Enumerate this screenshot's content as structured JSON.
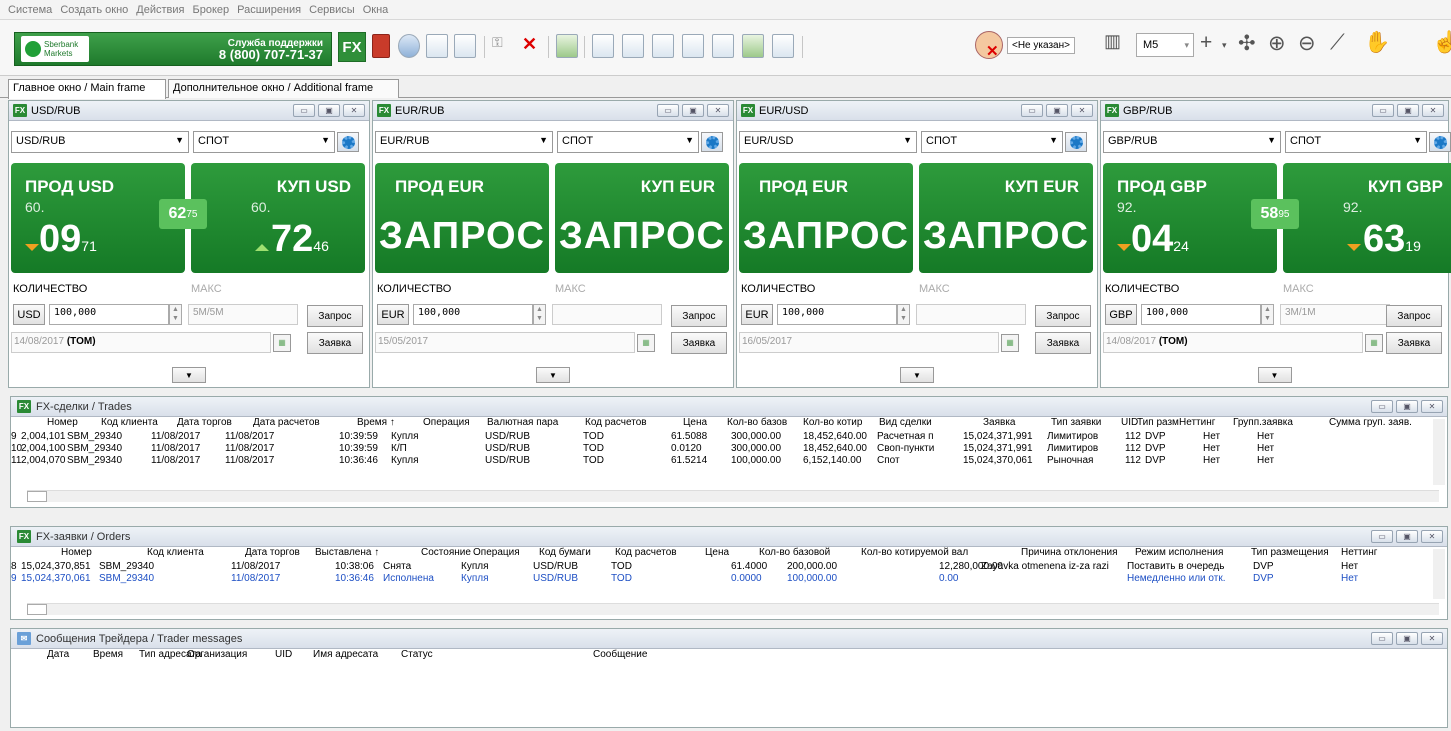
{
  "menu": [
    "Система",
    "Создать окно",
    "Действия",
    "Брокер",
    "Расширения",
    "Сервисы",
    "Окна"
  ],
  "toolbar": {
    "brand_line1": "Sberbank",
    "brand_line2": "Markets",
    "support_label": "Служба поддержки",
    "support_phone": "8 (800) 707-71-37",
    "fx_label": "FX",
    "user_name": "<Не указан>",
    "timeframe": "M5"
  },
  "tabs": [
    "Главное окно / Main frame",
    "Дополнительное окно / Additional frame"
  ],
  "panels": [
    {
      "title": "USD/RUB",
      "pair": "USD/RUB",
      "settle": "СПОТ",
      "sell_label": "ПРОД USD",
      "buy_label": "КУП USD",
      "sell_big": "60.",
      "sell_main": "09",
      "sell_frac": "71",
      "buy_big": "60.",
      "buy_main": "72",
      "buy_frac": "46",
      "spread_main": "62",
      "spread_frac": "75",
      "qty_label": "КОЛИЧЕСТВО",
      "max_label": "МАКС",
      "ccy": "USD",
      "amount": "100,000",
      "max_val": "5M/5M",
      "req_btn": "Запрос",
      "date": "14/08/2017",
      "tenor": "(TOM)",
      "order_btn": "Заявка"
    },
    {
      "title": "EUR/RUB",
      "pair": "EUR/RUB",
      "settle": "СПОТ",
      "sell_label": "ПРОД EUR",
      "buy_label": "КУП EUR",
      "sell_req": "ЗАПРОС",
      "buy_req": "ЗАПРОС",
      "qty_label": "КОЛИЧЕСТВО",
      "max_label": "МАКС",
      "ccy": "EUR",
      "amount": "100,000",
      "max_val": "",
      "req_btn": "Запрос",
      "date": "15/05/2017",
      "tenor": "",
      "order_btn": "Заявка"
    },
    {
      "title": "EUR/USD",
      "pair": "EUR/USD",
      "settle": "СПОТ",
      "sell_label": "ПРОД EUR",
      "buy_label": "КУП EUR",
      "sell_req": "ЗАПРОС",
      "buy_req": "ЗАПРОС",
      "qty_label": "КОЛИЧЕСТВО",
      "max_label": "МАКС",
      "ccy": "EUR",
      "amount": "100,000",
      "max_val": "",
      "req_btn": "Запрос",
      "date": "16/05/2017",
      "tenor": "",
      "order_btn": "Заявка"
    },
    {
      "title": "GBP/RUB",
      "pair": "GBP/RUB",
      "settle": "СПОТ",
      "sell_label": "ПРОД GBP",
      "buy_label": "КУП GBP",
      "sell_big": "92.",
      "sell_main": "04",
      "sell_frac": "24",
      "buy_big": "92.",
      "buy_main": "63",
      "buy_frac": "19",
      "spread_main": "58",
      "spread_frac": "95",
      "qty_label": "КОЛИЧЕСТВО",
      "max_label": "МАКС",
      "ccy": "GBP",
      "amount": "100,000",
      "max_val": "3M/1M",
      "req_btn": "Запрос",
      "date": "14/08/2017",
      "tenor": "(TOM)",
      "order_btn": "Заявка"
    }
  ],
  "trades": {
    "title": "FX-сделки / Trades",
    "headers": [
      "Номер",
      "Код клиента",
      "Дата торгов",
      "Дата расчетов",
      "Время",
      "Операция",
      "Валютная пара",
      "Код расчетов",
      "Цена",
      "Кол-во базов",
      "Кол-во котир",
      "Вид сделки",
      "Заявка",
      "Тип заявки",
      "UID",
      "Тип разм",
      "Неттинг",
      "Групп.заявка",
      "Сумма груп. заяв."
    ],
    "rows": [
      [
        "9",
        "2,004,101",
        "SBM_29340",
        "11/08/2017",
        "11/08/2017",
        "10:39:59",
        "Купля",
        "USD/RUB",
        "TOD",
        "61.5088",
        "300,000.00",
        "18,452,640.00",
        "Расчетная п",
        "15,024,371,991",
        "Лимитиров",
        "112",
        "DVP",
        "Нет",
        "Нет"
      ],
      [
        "10",
        "2,004,100",
        "SBM_29340",
        "11/08/2017",
        "11/08/2017",
        "10:39:59",
        "К/П",
        "USD/RUB",
        "TOD",
        "0.0120",
        "300,000.00",
        "18,452,640.00",
        "Своп-пункти",
        "15,024,371,991",
        "Лимитиров",
        "112",
        "DVP",
        "Нет",
        "Нет"
      ],
      [
        "11",
        "2,004,070",
        "SBM_29340",
        "11/08/2017",
        "11/08/2017",
        "10:36:46",
        "Купля",
        "USD/RUB",
        "TOD",
        "61.5214",
        "100,000.00",
        "6,152,140.00",
        "Спот",
        "15,024,370,061",
        "Рыночная",
        "112",
        "DVP",
        "Нет",
        "Нет"
      ]
    ]
  },
  "orders": {
    "title": "FX-заявки / Orders",
    "headers": [
      "Номер",
      "Код клиента",
      "Дата торгов",
      "Выставлена",
      "Состояние",
      "Операция",
      "Код бумаги",
      "Код расчетов",
      "Цена",
      "Кол-во базовой",
      "Кол-во котируемой вал",
      "Причина отклонения",
      "Режим исполнения",
      "Тип размещения",
      "Неттинг"
    ],
    "rows": [
      [
        "8",
        "15,024,370,851",
        "SBM_29340",
        "11/08/2017",
        "10:38:06",
        "Снята",
        "Купля",
        "USD/RUB",
        "TOD",
        "61.4000",
        "200,000.00",
        "12,280,000.00",
        "Zayavka otmenena iz-za razi",
        "Поставить в очередь",
        "DVP",
        "Нет"
      ],
      [
        "9",
        "15,024,370,061",
        "SBM_29340",
        "11/08/2017",
        "10:36:46",
        "Исполнена",
        "Купля",
        "USD/RUB",
        "TOD",
        "0.0000",
        "100,000.00",
        "0.00",
        "",
        "Немедленно или отк.",
        "DVP",
        "Нет"
      ]
    ]
  },
  "messages": {
    "title": "Сообщения Трейдера / Trader messages",
    "headers": [
      "Дата",
      "Время",
      "Тип адресата",
      "Организация",
      "UID",
      "Имя адресата",
      "Статус",
      "Сообщение"
    ]
  }
}
